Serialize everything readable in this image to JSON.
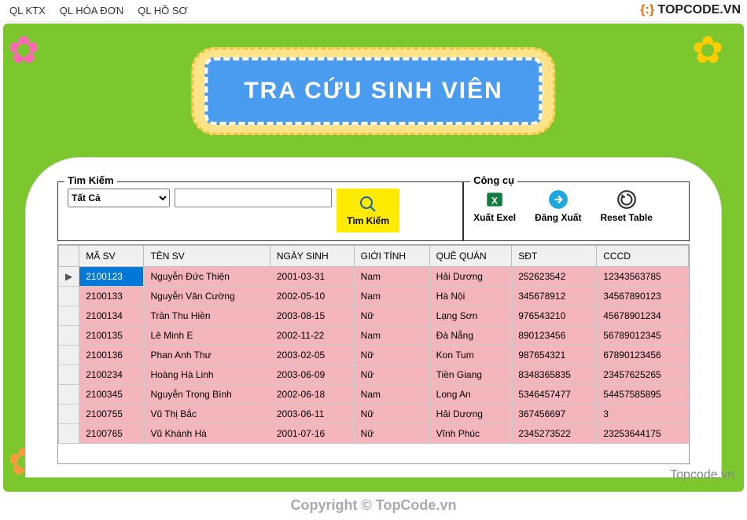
{
  "menu": {
    "ktx": "QL KTX",
    "hoadon": "QL HÓA ĐƠN",
    "hoso": "QL HỒ SƠ"
  },
  "watermark": {
    "bracket": "{:}",
    "text": "TOPCODE.VN",
    "lower": "Topcode.vn"
  },
  "copyright": "Copyright © TopCode.vn",
  "banner": "TRA CỨU SINH VIÊN",
  "search": {
    "legend": "Tìm Kiếm",
    "filter_selected": "Tất Cả",
    "query": "",
    "button": "Tìm Kiếm"
  },
  "tools": {
    "legend": "Công cụ",
    "export": "Xuất Exel",
    "logout": "Đăng Xuất",
    "reset": "Reset Table"
  },
  "table": {
    "headers": [
      "MÃ SV",
      "TÊN SV",
      "NGÀY SINH",
      "GIỚI TÍNH",
      "QUÊ QUÁN",
      "SĐT",
      "CCCD"
    ],
    "rows": [
      {
        "selected": true,
        "indicator": "▶",
        "cells": [
          "2100123",
          "Nguyễn Đức Thiện",
          "2001-03-31",
          "Nam",
          "Hải Dương",
          "252623542",
          "12343563785"
        ]
      },
      {
        "selected": false,
        "indicator": "",
        "cells": [
          "2100133",
          "Nguyễn Văn Cường",
          "2002-05-10",
          "Nam",
          "Hà Nội",
          "345678912",
          "34567890123"
        ]
      },
      {
        "selected": false,
        "indicator": "",
        "cells": [
          "2100134",
          "Trần Thu Hiền",
          "2003-08-15",
          "Nữ",
          "Lạng Sơn",
          "976543210",
          "45678901234"
        ]
      },
      {
        "selected": false,
        "indicator": "",
        "cells": [
          "2100135",
          "Lê Minh E",
          "2002-11-22",
          "Nam",
          "Đà Nẵng",
          "890123456",
          "56789012345"
        ]
      },
      {
        "selected": false,
        "indicator": "",
        "cells": [
          "2100136",
          "Phan Anh Thư",
          "2003-02-05",
          "Nữ",
          "Kon Tum",
          "987654321",
          "67890123456"
        ]
      },
      {
        "selected": false,
        "indicator": "",
        "cells": [
          "2100234",
          "Hoàng Hà Linh",
          "2003-06-09",
          "Nữ",
          "Tiền Giang",
          "8348365835",
          "23457625265"
        ]
      },
      {
        "selected": false,
        "indicator": "",
        "cells": [
          "2100345",
          "Nguyễn Trọng Bình",
          "2002-06-18",
          "Nam",
          "Long An",
          "5346457477",
          "54457585895"
        ]
      },
      {
        "selected": false,
        "indicator": "",
        "cells": [
          "2100755",
          "Vũ Thị Bắc",
          "2003-06-11",
          "Nữ",
          "Hải Dương",
          "367456697",
          "3"
        ]
      },
      {
        "selected": false,
        "indicator": "",
        "cells": [
          "2100765",
          "Vũ Khánh Hà",
          "2001-07-16",
          "Nữ",
          "Vĩnh Phúc",
          "2345273522",
          "23253644175"
        ]
      }
    ]
  }
}
